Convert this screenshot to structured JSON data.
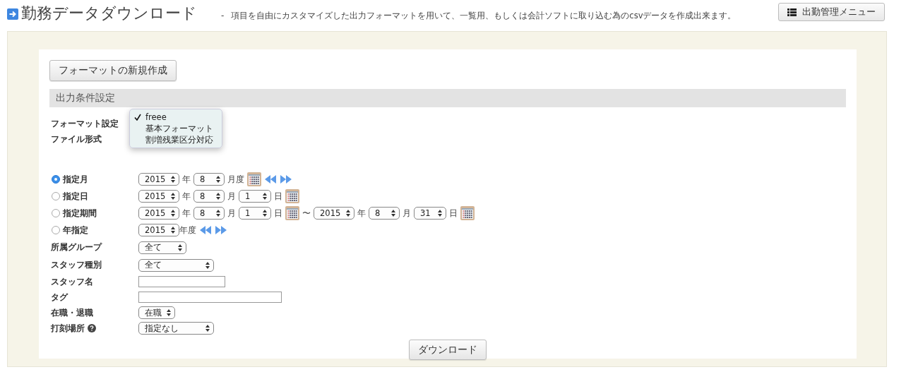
{
  "header": {
    "title": "勤務データダウンロード",
    "separator": "-",
    "description": "項目を自由にカスタマイズした出力フォーマットを用いて、一覧用、もしくは会計ソフトに取り込む為のcsvデータを作成出来ます。",
    "menu_button": "出勤管理メニュー"
  },
  "new_format_button": "フォーマットの新規作成",
  "section_title": "出力条件設定",
  "format_setting": {
    "label": "フォーマット設定",
    "options": [
      {
        "label": "freee",
        "selected": true
      },
      {
        "label": "基本フォーマット",
        "selected": false
      },
      {
        "label": "割増残業区分対応",
        "selected": false
      }
    ]
  },
  "file_type": {
    "label": "ファイル形式"
  },
  "periods": [
    {
      "label": "指定月",
      "selected": true,
      "parts": [
        {
          "kind": "year",
          "value": "2015"
        },
        {
          "kind": "unit",
          "text": "年"
        },
        {
          "kind": "month",
          "value": "8"
        },
        {
          "kind": "unit",
          "text": "月度"
        },
        {
          "kind": "calendar"
        },
        {
          "kind": "nav"
        }
      ]
    },
    {
      "label": "指定日",
      "selected": false,
      "parts": [
        {
          "kind": "year",
          "value": "2015"
        },
        {
          "kind": "unit",
          "text": "年"
        },
        {
          "kind": "month",
          "value": "8"
        },
        {
          "kind": "unit",
          "text": "月"
        },
        {
          "kind": "day",
          "value": "1"
        },
        {
          "kind": "unit",
          "text": "日"
        },
        {
          "kind": "calendar"
        }
      ]
    },
    {
      "label": "指定期間",
      "selected": false,
      "parts": [
        {
          "kind": "year",
          "value": "2015"
        },
        {
          "kind": "unit",
          "text": "年"
        },
        {
          "kind": "month",
          "value": "8"
        },
        {
          "kind": "unit",
          "text": "月"
        },
        {
          "kind": "day",
          "value": "1"
        },
        {
          "kind": "unit",
          "text": "日"
        },
        {
          "kind": "calendar"
        },
        {
          "kind": "unit",
          "text": "〜"
        },
        {
          "kind": "year",
          "value": "2015"
        },
        {
          "kind": "unit",
          "text": "年"
        },
        {
          "kind": "month",
          "value": "8"
        },
        {
          "kind": "unit",
          "text": "月"
        },
        {
          "kind": "day",
          "value": "31"
        },
        {
          "kind": "unit",
          "text": "日"
        },
        {
          "kind": "calendar"
        }
      ]
    },
    {
      "label": "年指定",
      "selected": false,
      "parts": [
        {
          "kind": "year",
          "value": "2015"
        },
        {
          "kind": "tight-unit",
          "text": "年度"
        },
        {
          "kind": "nav"
        }
      ]
    }
  ],
  "filters": [
    {
      "label": "所属グループ",
      "kind": "select",
      "value": "全て",
      "help": false
    },
    {
      "label": "スタッフ種別",
      "kind": "select",
      "value": "全て",
      "help": false
    },
    {
      "label": "スタッフ名",
      "kind": "input",
      "help": false
    },
    {
      "label": "タグ",
      "kind": "input",
      "help": false
    },
    {
      "label": "在職・退職",
      "kind": "select",
      "value": "在職",
      "help": false
    },
    {
      "label": "打刻場所",
      "kind": "select",
      "value": "指定なし",
      "help": true
    }
  ],
  "download_button": "ダウンロード"
}
